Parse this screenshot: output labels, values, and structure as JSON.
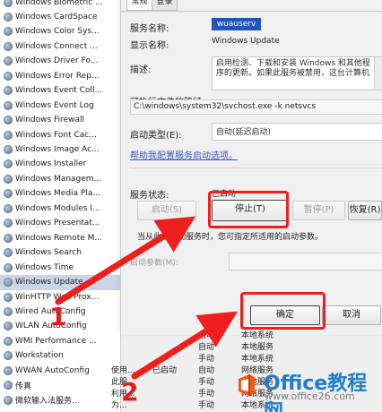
{
  "services": [
    {
      "name": "Windows Biometric ..."
    },
    {
      "name": "Windows CardSpace"
    },
    {
      "name": "Windows Color Sys..."
    },
    {
      "name": "Windows Connect ..."
    },
    {
      "name": "Windows Driver Fo..."
    },
    {
      "name": "Windows Error Rep..."
    },
    {
      "name": "Windows Event Coll..."
    },
    {
      "name": "Windows Event Log"
    },
    {
      "name": "Windows Firewall"
    },
    {
      "name": "Windows Font Cac..."
    },
    {
      "name": "Windows Image Ac..."
    },
    {
      "name": "Windows Installer"
    },
    {
      "name": "Windows Managem..."
    },
    {
      "name": "Windows Media Pla..."
    },
    {
      "name": "Windows Modules I..."
    },
    {
      "name": "Windows Presentat..."
    },
    {
      "name": "Windows Remote M..."
    },
    {
      "name": "Windows Search"
    },
    {
      "name": "Windows Time"
    },
    {
      "name": "Windows Update",
      "selected": true
    },
    {
      "name": "WinHTTP Web Prox..."
    },
    {
      "name": "Wired AutoConfig"
    },
    {
      "name": "WLAN AutoConfig"
    },
    {
      "name": "WMI Performance ..."
    },
    {
      "name": "Workstation"
    },
    {
      "name": "WWAN AutoConfig"
    },
    {
      "name": "传真"
    },
    {
      "name": "微软输入法服务..."
    }
  ],
  "dialog": {
    "tabs": [
      "常规",
      "登录"
    ],
    "service_name_label": "服务名称:",
    "service_name_value": "wuauserv",
    "display_name_label": "显示名称:",
    "display_name_value": "Windows Update",
    "description_label": "描述:",
    "description_text": "启用检测、下载和安装 Windows 和其他程序的更新。如果此服务被禁用，这台计算机",
    "path_label": "可执行文件的路径:",
    "path_value": "C:\\windows\\system32\\svchost.exe -k netsvcs",
    "startup_type_label": "启动类型(E):",
    "startup_type_value": "自动(延迟启动)",
    "help_link": "帮助我配置服务启动选项。",
    "status_label": "服务状态:",
    "status_value": "已启动",
    "start_button": "启动(S)",
    "stop_button": "停止(T)",
    "pause_button": "暂停(P)",
    "resume_button": "恢复(R)",
    "start_hint": "当从此处启动服务时，您可指定所适用的启动参数。",
    "start_param_label": "启动参数(M):",
    "ok_button": "确定",
    "cancel_button": "取消"
  },
  "lower_rows": [
    {
      "desc": "",
      "status": "",
      "startup": "自动",
      "logon": "本地系统"
    },
    {
      "desc": "",
      "status": "",
      "startup": "自动",
      "logon": "本地服务"
    },
    {
      "desc": "",
      "status": "",
      "startup": "手动",
      "logon": "本地系统"
    },
    {
      "desc": "使用...",
      "status": "已启动",
      "startup": "自动",
      "logon": "网络服务"
    },
    {
      "desc": "此服...",
      "status": "",
      "startup": "手动",
      "logon": "本地服务"
    },
    {
      "desc": "利用...",
      "status": "",
      "startup": "手动",
      "logon": "网络服务"
    },
    {
      "desc": "为...",
      "status": "",
      "startup": "手动",
      "logon": "本地系统"
    }
  ],
  "annotations": {
    "step1": "1",
    "step2": "2",
    "highlight_color": "#ef1f1f"
  },
  "watermark": {
    "title": "Office教程网",
    "url": "www.office26.com"
  }
}
